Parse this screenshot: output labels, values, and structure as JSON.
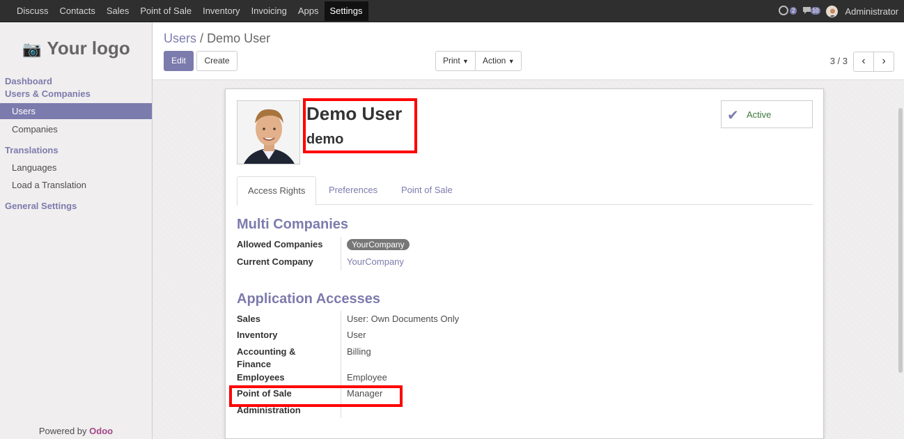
{
  "topbar": {
    "apps": [
      "Discuss",
      "Contacts",
      "Sales",
      "Point of Sale",
      "Inventory",
      "Invoicing",
      "Apps",
      "Settings"
    ],
    "active_app": "Settings",
    "chat_count": "2",
    "message_count": "10",
    "user": "Administrator"
  },
  "sidebar": {
    "logo_text": "Your logo",
    "sections": {
      "dashboard": "Dashboard",
      "users_companies": "Users & Companies",
      "translations": "Translations",
      "general_settings": "General Settings"
    },
    "items": {
      "users": "Users",
      "companies": "Companies",
      "languages": "Languages",
      "load_translation": "Load a Translation"
    },
    "powered_by": "Powered by",
    "powered_brand": "Odoo"
  },
  "control": {
    "breadcrumb_parent": "Users",
    "breadcrumb_sep": "/",
    "breadcrumb_current": "Demo User",
    "edit": "Edit",
    "create": "Create",
    "print": "Print",
    "action": "Action",
    "pager": "3 / 3"
  },
  "form": {
    "name": "Demo User",
    "login": "demo",
    "active_label": "Active",
    "tabs": [
      "Access Rights",
      "Preferences",
      "Point of Sale"
    ],
    "multi_companies": {
      "title": "Multi Companies",
      "allowed_label": "Allowed Companies",
      "allowed_value": "YourCompany",
      "current_label": "Current Company",
      "current_value": "YourCompany"
    },
    "app_access": {
      "title": "Application Accesses",
      "rows": [
        {
          "label": "Sales",
          "value": "User: Own Documents Only"
        },
        {
          "label": "Inventory",
          "value": "User"
        },
        {
          "label": "Accounting &",
          "label2": "Finance",
          "value": "Billing"
        },
        {
          "label": "Employees",
          "value": "Employee"
        },
        {
          "label": "Point of Sale",
          "value": "Manager"
        },
        {
          "label": "Administration",
          "value": ""
        }
      ]
    }
  },
  "colors": {
    "accent": "#7c7bad",
    "highlight": "#ff0000",
    "topbar": "#2f2f2f"
  }
}
